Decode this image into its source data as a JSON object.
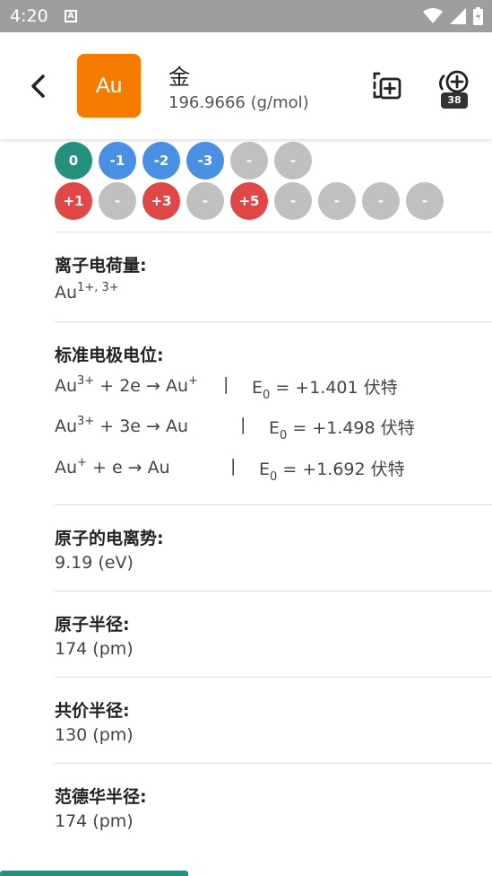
{
  "status": {
    "time": "4:20",
    "notification_letter": "A"
  },
  "header": {
    "symbol": "Au",
    "name": "金",
    "mass": "196.9666 (g/mol)",
    "compare_count": "38",
    "accent_color": "#f57c00"
  },
  "oxidation_states": {
    "row1": [
      "0",
      "-1",
      "-2",
      "-3",
      "-",
      "-"
    ],
    "row2": [
      "+1",
      "-",
      "+3",
      "-",
      "+5",
      "-",
      "-",
      "-",
      "-"
    ]
  },
  "ion_charge": {
    "title": "离子电荷量:",
    "base": "Au",
    "sup": "1+, 3+"
  },
  "electrode": {
    "title": "标准电极电位:",
    "equations": [
      {
        "lhs_a": "Au",
        "lhs_sup": "3+",
        "mid": " + 2e → Au",
        "rhs_sup": "+",
        "pipe": "|",
        "e": "E",
        "e_sub": "0",
        "value": " = +1.401 伏特"
      },
      {
        "lhs_a": "Au",
        "lhs_sup": "3+",
        "mid": " + 3e → Au",
        "rhs_sup": "",
        "pipe": "|",
        "e": "E",
        "e_sub": "0",
        "value": " = +1.498 伏特"
      },
      {
        "lhs_a": "Au",
        "lhs_sup": "+",
        "mid": " + e → Au",
        "rhs_sup": "",
        "pipe": "|",
        "e": "E",
        "e_sub": "0",
        "value": " = +1.692 伏特"
      }
    ]
  },
  "ionization": {
    "title": "原子的电离势:",
    "value": "9.19 (eV)"
  },
  "atomic_radius": {
    "title": "原子半径:",
    "value": "174 (pm)"
  },
  "covalent_radius": {
    "title": "共价半径:",
    "value": "130 (pm)"
  },
  "vdw_radius": {
    "title": "范德华半径:",
    "value": "174 (pm)"
  }
}
